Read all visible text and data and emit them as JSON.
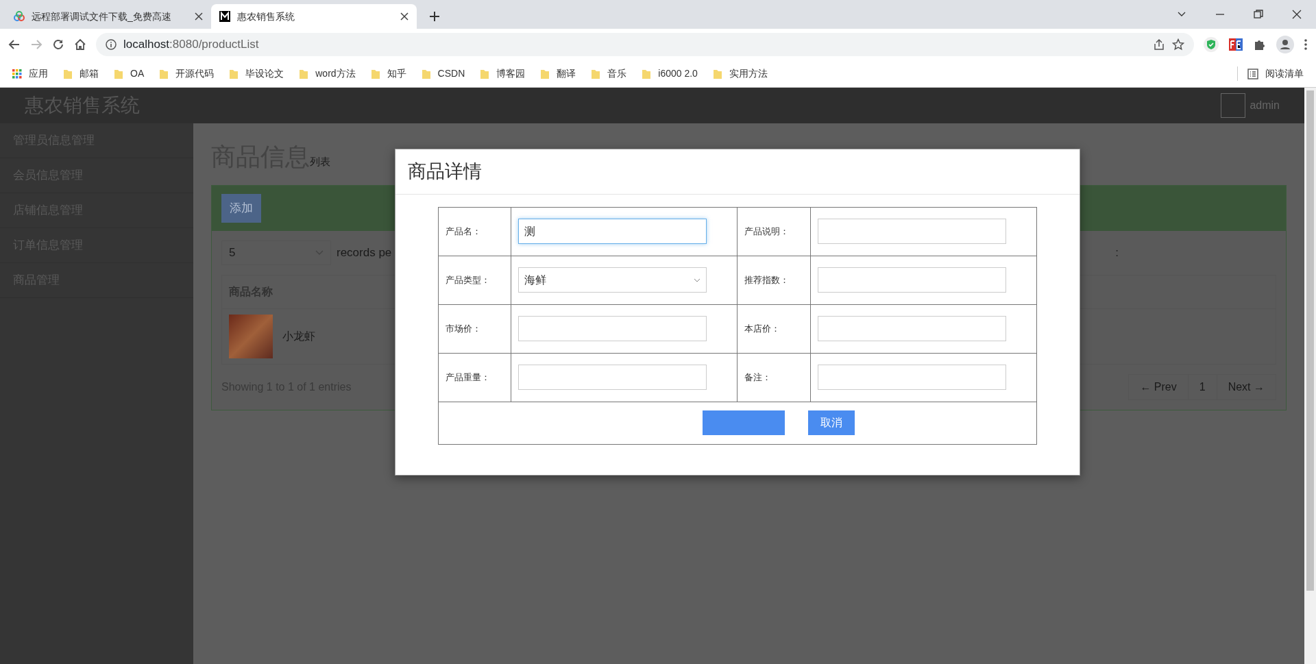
{
  "browser": {
    "tabs": [
      {
        "title": "远程部署调试文件下载_免费高速",
        "selected": false
      },
      {
        "title": "惠农销售系统",
        "selected": true
      }
    ],
    "url_host": "localhost",
    "url_rest": ":8080/productList",
    "apps_label": "应用",
    "bookmarks": [
      "邮箱",
      "OA",
      "开源代码",
      "毕设论文",
      "word方法",
      "知乎",
      "CSDN",
      "博客园",
      "翻译",
      "音乐",
      "i6000 2.0",
      "实用方法"
    ],
    "reading_list": "阅读清单"
  },
  "header": {
    "brand": "惠农销售系统",
    "user": "admin"
  },
  "sidebar": {
    "items": [
      "管理员信息管理",
      "会员信息管理",
      "店铺信息管理",
      "订单信息管理",
      "商品管理"
    ]
  },
  "page": {
    "title": "商品信息",
    "subtitle": "列表",
    "add_button": "添加",
    "page_size": "5",
    "page_size_label": "records pe",
    "search_label": ":",
    "table": {
      "columns": [
        "商品名称"
      ],
      "rows": [
        [
          "小龙虾"
        ]
      ]
    },
    "info": "Showing 1 to 1 of 1 entries",
    "pagination": [
      "← Prev",
      "1",
      "Next →"
    ]
  },
  "modal": {
    "title": "商品详情",
    "rows": [
      [
        {
          "label": "产品名：",
          "kind": "text",
          "value": "测",
          "focused": true
        },
        {
          "label": "产品说明：",
          "kind": "text",
          "focused": false
        }
      ],
      [
        {
          "label": "产品类型：",
          "kind": "select",
          "value": "海鲜",
          "focused": false
        },
        {
          "label": "推荐指数：",
          "kind": "text",
          "focused": false
        }
      ],
      [
        {
          "label": "市场价：",
          "kind": "text",
          "focused": false
        },
        {
          "label": "本店价：",
          "kind": "text",
          "focused": false
        }
      ],
      [
        {
          "label": "产品重量：",
          "kind": "text",
          "focused": false
        },
        {
          "label": "备注：",
          "kind": "text",
          "focused": false
        }
      ]
    ],
    "buttons": [
      {
        "kind": "save"
      },
      {
        "kind": "cancel",
        "label": "取消"
      }
    ]
  }
}
